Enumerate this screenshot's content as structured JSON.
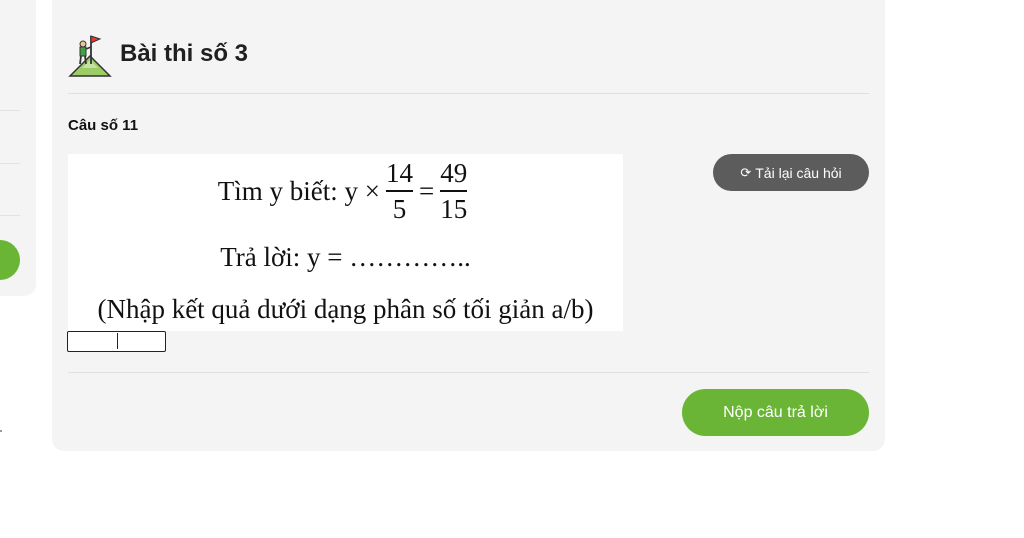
{
  "exam": {
    "title": "Bài thi số 3",
    "icon": "climber-flag-icon"
  },
  "question": {
    "label": "Câu số 11",
    "prompt_prefix": "Tìm y biết: y ×",
    "frac1_num": "14",
    "frac1_den": "5",
    "equals": "=",
    "frac2_num": "49",
    "frac2_den": "15",
    "answer_line": "Trả lời: y = …………..",
    "note": "(Nhập kết quả dưới dạng phân số tối giản a/b)"
  },
  "answer": {
    "value": "",
    "placeholder": ""
  },
  "buttons": {
    "reload_label": "Tải lại câu hỏi",
    "reload_icon": "refresh-icon",
    "submit_label": "Nộp câu trả lời"
  },
  "colors": {
    "accent": "#6ab536",
    "reload_bg": "#5c5c5c",
    "card_bg": "#f4f4f4"
  }
}
